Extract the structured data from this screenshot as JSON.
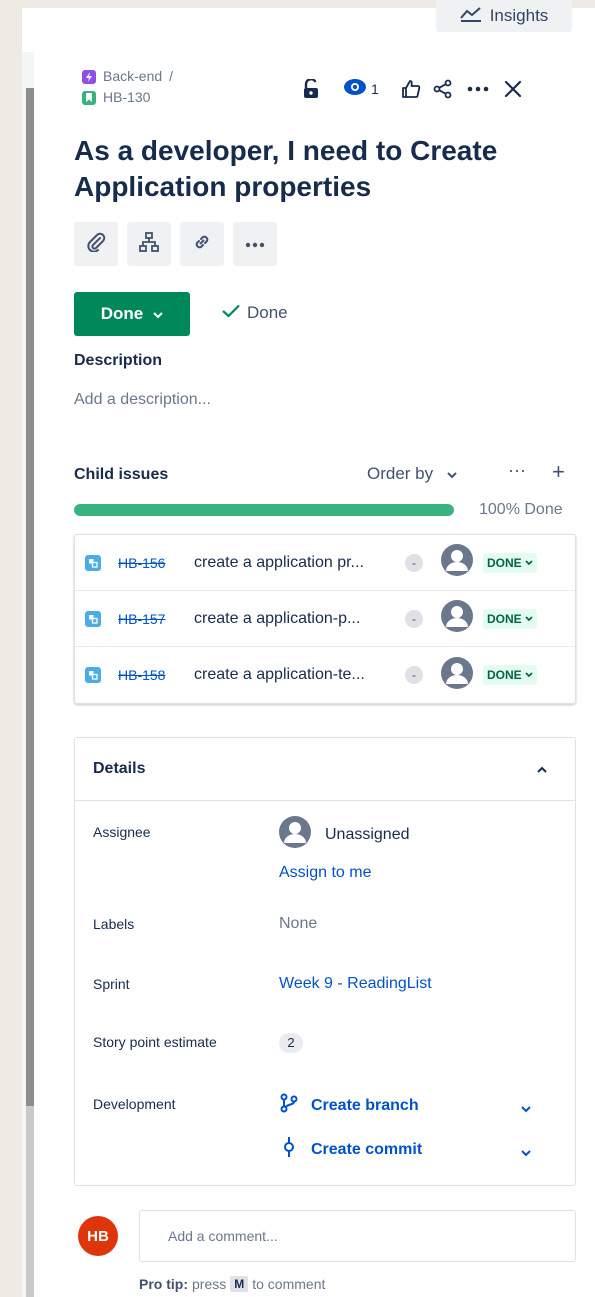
{
  "toolbar": {
    "insights_label": "Insights"
  },
  "breadcrumb": {
    "parent": "Back-end",
    "separator": "/",
    "issue_key": "HB-130"
  },
  "actions": {
    "watch_count": "1"
  },
  "issue": {
    "title": "As a developer, I need to Create Application properties"
  },
  "status": {
    "button_label": "Done",
    "resolution": "Done"
  },
  "description": {
    "heading": "Description",
    "placeholder": "Add a description..."
  },
  "child_issues": {
    "heading": "Child issues",
    "order_by_label": "Order by",
    "more_label": "···",
    "add_label": "+",
    "progress_percent": 100,
    "progress_label": "100% Done",
    "items": [
      {
        "key": "HB-156",
        "summary": "create a application pr...",
        "priority": "-",
        "status": "DONE"
      },
      {
        "key": "HB-157",
        "summary": "create a application-p...",
        "priority": "-",
        "status": "DONE"
      },
      {
        "key": "HB-158",
        "summary": "create a application-te...",
        "priority": "-",
        "status": "DONE"
      }
    ]
  },
  "details": {
    "heading": "Details",
    "assignee_label": "Assignee",
    "assignee_value": "Unassigned",
    "assign_to_me": "Assign to me",
    "labels_label": "Labels",
    "labels_value": "None",
    "sprint_label": "Sprint",
    "sprint_value": "Week 9 - ReadingList",
    "story_points_label": "Story point estimate",
    "story_points_value": "2",
    "development_label": "Development",
    "create_branch": "Create branch",
    "create_commit": "Create commit"
  },
  "comment": {
    "avatar_initials": "HB",
    "placeholder": "Add a comment...",
    "protip_bold": "Pro tip:",
    "protip_text": "press",
    "protip_key": "M",
    "protip_suffix": "to comment"
  },
  "colors": {
    "status_done": "#00875a",
    "progress": "#36b37e",
    "link": "#0052cc",
    "commenter_avatar": "#de350b"
  }
}
